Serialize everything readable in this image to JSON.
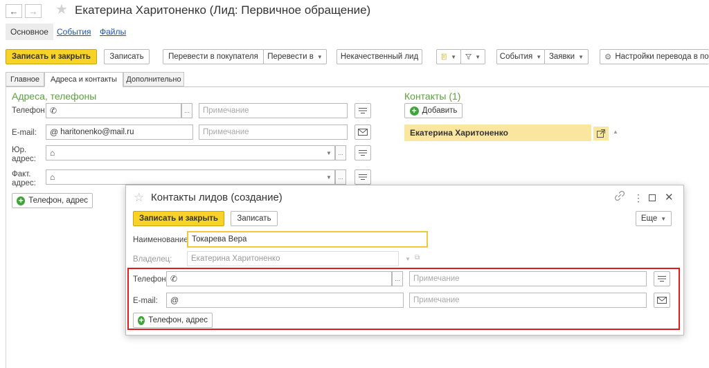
{
  "window": {
    "title": "Екатерина Харитоненко (Лид: Первичное обращение)",
    "nav_back": "←",
    "nav_forward": "→"
  },
  "sections": {
    "main": "Основное",
    "events": "События",
    "files": "Файлы"
  },
  "toolbar": {
    "save_close": "Записать и закрыть",
    "save": "Записать",
    "convert_customer": "Перевести в покупателя",
    "convert_to": "Перевести в",
    "bad_lead": "Некачественный лид",
    "events": "События",
    "requests": "Заявки",
    "settings": "Настройки перевода в поку"
  },
  "tabs": [
    "Главное",
    "Адреса и контакты",
    "Дополнительно"
  ],
  "addresses": {
    "group_title": "Адреса, телефоны",
    "phone_label": "Телефон:",
    "phone_value": "",
    "note_placeholder": "Примечание",
    "email_label": "E-mail:",
    "email_value": "haritonenko@mail.ru",
    "legal_label_1": "Юр.",
    "legal_label_2": "адрес:",
    "fact_label_1": "Факт.",
    "fact_label_2": "адрес:",
    "add_button": "Телефон, адрес"
  },
  "contacts": {
    "group_title": "Контакты (1)",
    "add_button": "Добавить",
    "items": [
      "Екатерина Харитоненко"
    ]
  },
  "dialog": {
    "title": "Контакты лидов (создание)",
    "save_close": "Записать и закрыть",
    "save": "Записать",
    "more": "Еще",
    "name_label": "Наименование:",
    "name_value": "Токарева Вера",
    "owner_label": "Владелец:",
    "owner_value": "Екатерина Харитоненко",
    "phone_label": "Телефон:",
    "note_placeholder": "Примечание",
    "email_label": "E-mail:",
    "add_button": "Телефон, адрес"
  },
  "colors": {
    "accent_yellow": "#f7d328",
    "group_green": "#5aa33a",
    "highlight_red": "#e01b1b",
    "contact_highlight": "#fbe6a0",
    "link_blue": "#1b55a6"
  }
}
